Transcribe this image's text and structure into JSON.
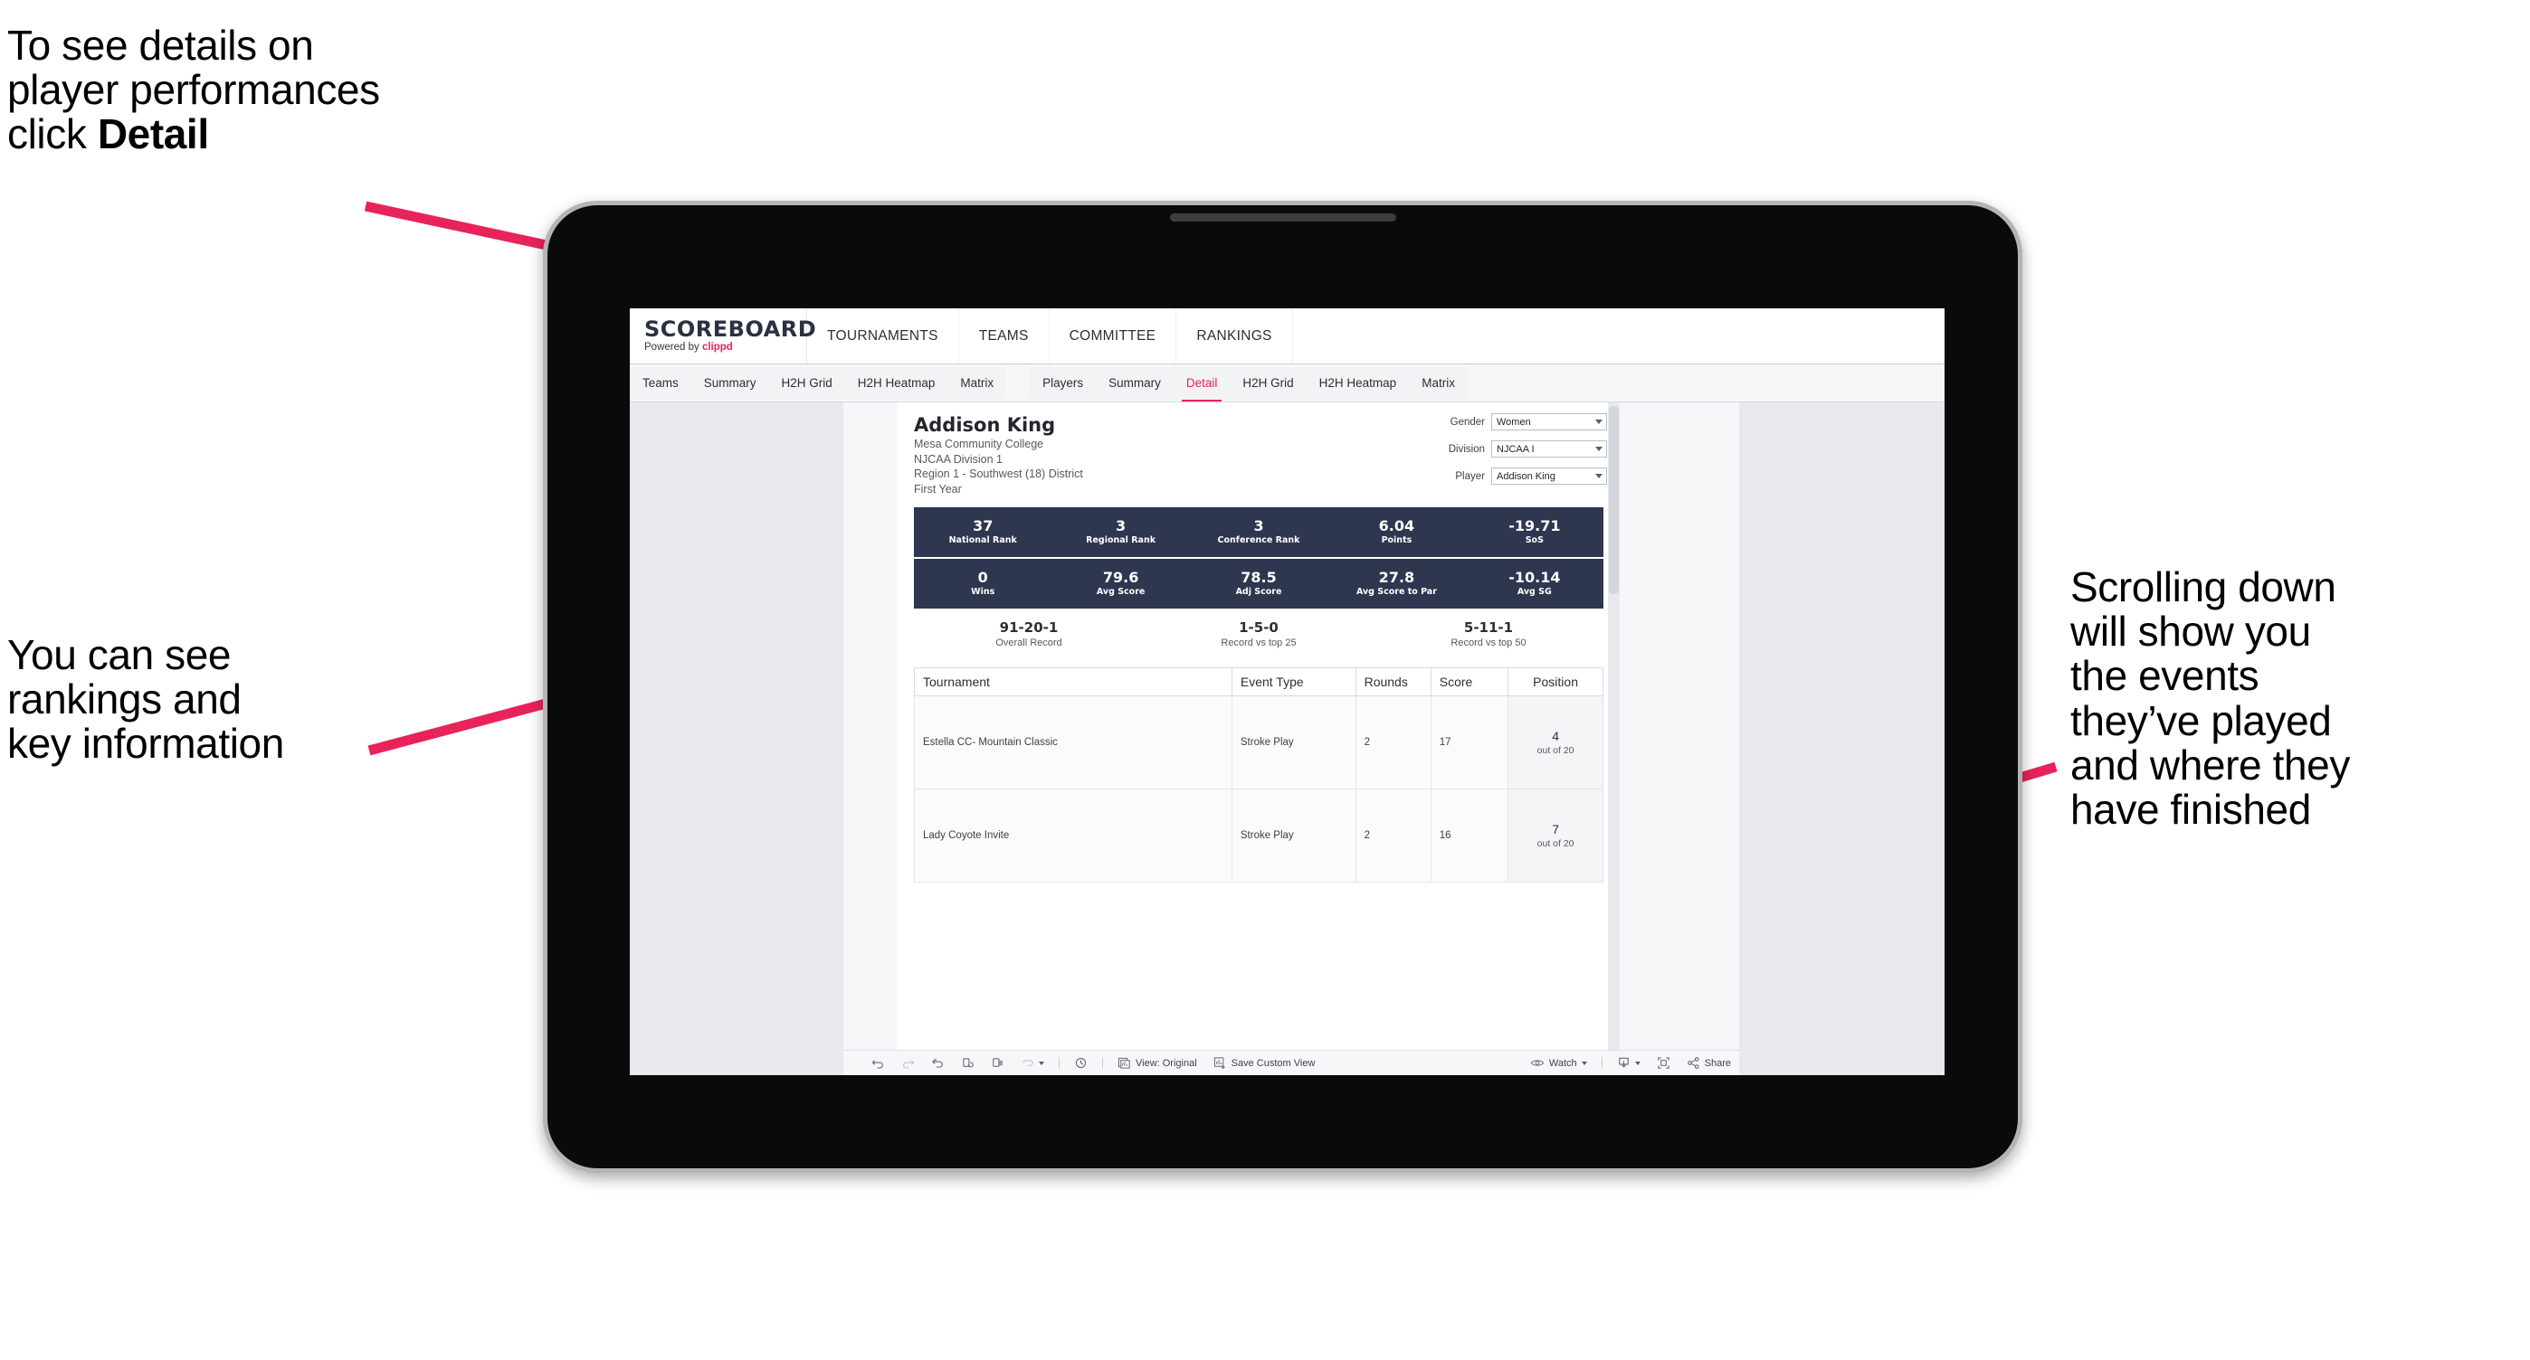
{
  "annotations": {
    "detail": "To see details on\nplayer performances\nclick ",
    "detail_bold": "Detail",
    "rankings": "You can see\nrankings and\nkey information",
    "scrolling": "Scrolling down\nwill show you\nthe events\nthey’ve played\nand where they\nhave finished"
  },
  "colors": {
    "accent_pink": "#e8235a",
    "arrow_pink": "#e8235a",
    "stat_bar_navy": "#2f3650",
    "screen_bg": "#e7e9ec"
  },
  "app": {
    "brand": {
      "name": "SCOREBOARD",
      "powered_prefix": "Powered by ",
      "powered_brand": "clippd"
    },
    "topnav": [
      {
        "label": "TOURNAMENTS"
      },
      {
        "label": "TEAMS"
      },
      {
        "label": "COMMITTEE"
      },
      {
        "label": "RANKINGS"
      }
    ],
    "subnav": {
      "group_teams": [
        {
          "label": "Teams",
          "active": false
        },
        {
          "label": "Summary",
          "active": false
        },
        {
          "label": "H2H Grid",
          "active": false
        },
        {
          "label": "H2H Heatmap",
          "active": false
        },
        {
          "label": "Matrix",
          "active": false
        }
      ],
      "group_players": [
        {
          "label": "Players",
          "active": false
        },
        {
          "label": "Summary",
          "active": false
        },
        {
          "label": "Detail",
          "active": true
        },
        {
          "label": "H2H Grid",
          "active": false
        },
        {
          "label": "H2H Heatmap",
          "active": false
        },
        {
          "label": "Matrix",
          "active": false
        }
      ]
    }
  },
  "player": {
    "name": "Addison King",
    "school": "Mesa Community College",
    "division": "NJCAA Division 1",
    "region": "Region 1 - Southwest (18) District",
    "year": "First Year"
  },
  "filters": [
    {
      "label": "Gender",
      "value": "Women"
    },
    {
      "label": "Division",
      "value": "NJCAA I"
    },
    {
      "label": "Player",
      "value": "Addison King"
    }
  ],
  "stats_row_1": [
    {
      "value": "37",
      "label": "National Rank"
    },
    {
      "value": "3",
      "label": "Regional Rank"
    },
    {
      "value": "3",
      "label": "Conference Rank"
    },
    {
      "value": "6.04",
      "label": "Points"
    },
    {
      "value": "-19.71",
      "label": "SoS"
    }
  ],
  "stats_row_2": [
    {
      "value": "0",
      "label": "Wins"
    },
    {
      "value": "79.6",
      "label": "Avg Score"
    },
    {
      "value": "78.5",
      "label": "Adj Score"
    },
    {
      "value": "27.8",
      "label": "Avg Score to Par"
    },
    {
      "value": "-10.14",
      "label": "Avg SG"
    }
  ],
  "records": [
    {
      "value": "91-20-1",
      "label": "Overall Record"
    },
    {
      "value": "1-5-0",
      "label": "Record vs top 25"
    },
    {
      "value": "5-11-1",
      "label": "Record vs top 50"
    }
  ],
  "tournaments": {
    "headers": [
      "Tournament",
      "Event Type",
      "Rounds",
      "Score",
      "Position"
    ],
    "rows": [
      {
        "tournament": "Estella CC- Mountain Classic",
        "event_type": "Stroke Play",
        "rounds": "2",
        "score": "17",
        "position": "4",
        "position_of": "out of 20"
      },
      {
        "tournament": "Lady Coyote Invite",
        "event_type": "Stroke Play",
        "rounds": "2",
        "score": "16",
        "position": "7",
        "position_of": "out of 20"
      }
    ]
  },
  "toolbar": {
    "undo": "undo-icon",
    "redo": "redo-icon",
    "revert": "revert-icon",
    "refresh": "refresh-icon",
    "pause": "pause-icon",
    "view_original": "View: Original",
    "save_custom_view": "Save Custom View",
    "watch": "Watch",
    "share": "Share"
  }
}
